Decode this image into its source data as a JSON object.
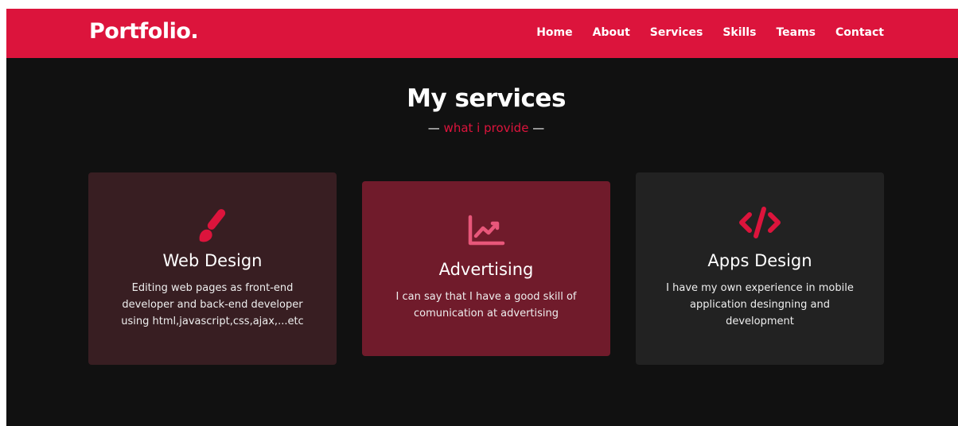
{
  "brand": {
    "logo": "Portfolio."
  },
  "nav": {
    "items": [
      "Home",
      "About",
      "Services",
      "Skills",
      "Teams",
      "Contact"
    ]
  },
  "section": {
    "title": "My services",
    "subtitle": "what i provide",
    "dash": "—"
  },
  "cards": [
    {
      "icon": "paint-brush-icon",
      "title": "Web Design",
      "description": "Editing web pages as front-end developer and back-end developer using html,javascript,css,ajax,...etc"
    },
    {
      "icon": "chart-line-icon",
      "title": "Advertising",
      "description": "I can say that I have a good skill of comunication at advertising"
    },
    {
      "icon": "code-icon",
      "title": "Apps Design",
      "description": "I have my own experience in mobile application desingning and development"
    }
  ],
  "colors": {
    "accent": "#dc143c",
    "background": "#111111",
    "card1": "#381e22",
    "card2": "#701b2b",
    "card3": "#222222"
  }
}
